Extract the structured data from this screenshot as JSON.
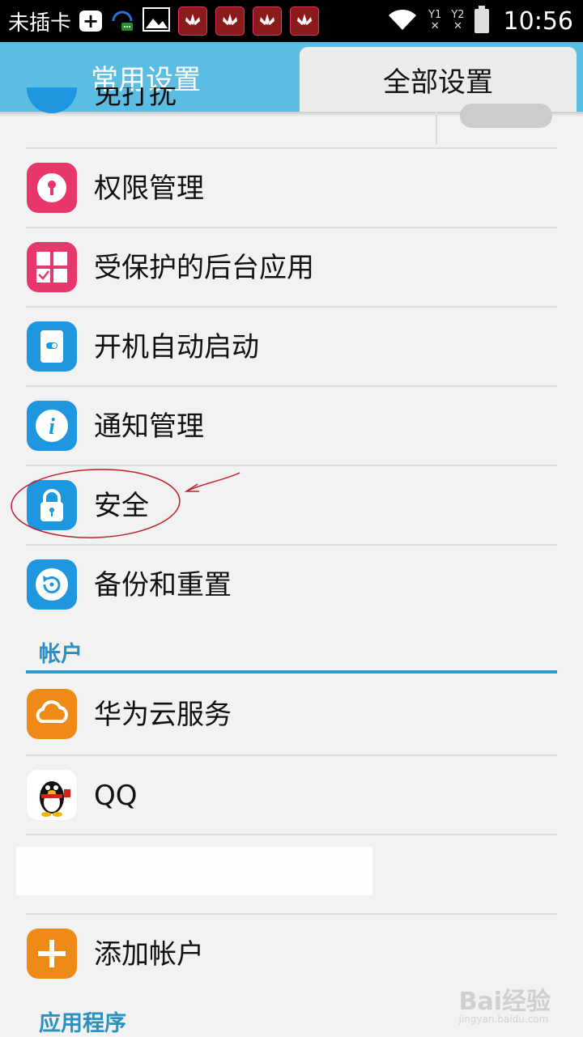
{
  "status_bar": {
    "carrier": "未插卡",
    "sim1": "Y1",
    "sim2": "Y2",
    "time": "10:56"
  },
  "tabs": [
    {
      "label": "常用设置"
    },
    {
      "label": "全部设置"
    }
  ],
  "list": {
    "partial_item": {
      "label": "免打扰"
    },
    "items": [
      {
        "label": "权限管理",
        "icon": "key-icon",
        "color": "#e8376b"
      },
      {
        "label": "受保护的后台应用",
        "icon": "protected-apps-icon",
        "color": "#e8376b"
      },
      {
        "label": "开机自动启动",
        "icon": "auto-start-icon",
        "color": "#1f97e0"
      },
      {
        "label": "通知管理",
        "icon": "info-icon",
        "color": "#1f97e0"
      },
      {
        "label": "安全",
        "icon": "lock-icon",
        "color": "#1f97e0"
      },
      {
        "label": "备份和重置",
        "icon": "backup-icon",
        "color": "#1f97e0"
      }
    ],
    "account_section": "帐户",
    "account_items": [
      {
        "label": "华为云服务",
        "icon": "cloud-icon",
        "color": "#f08a17"
      },
      {
        "label": "QQ",
        "icon": "qq-penguin-icon"
      },
      {
        "label": "添加帐户",
        "icon": "plus-icon",
        "color": "#f08a17"
      }
    ],
    "app_section": "应用程序"
  },
  "watermark": {
    "brand": "Bai经验",
    "url": "jingyan.baidu.com"
  },
  "colors": {
    "tab_bar": "#5bbde2",
    "section": "#2a91c0",
    "annotation": "#c0202a"
  }
}
